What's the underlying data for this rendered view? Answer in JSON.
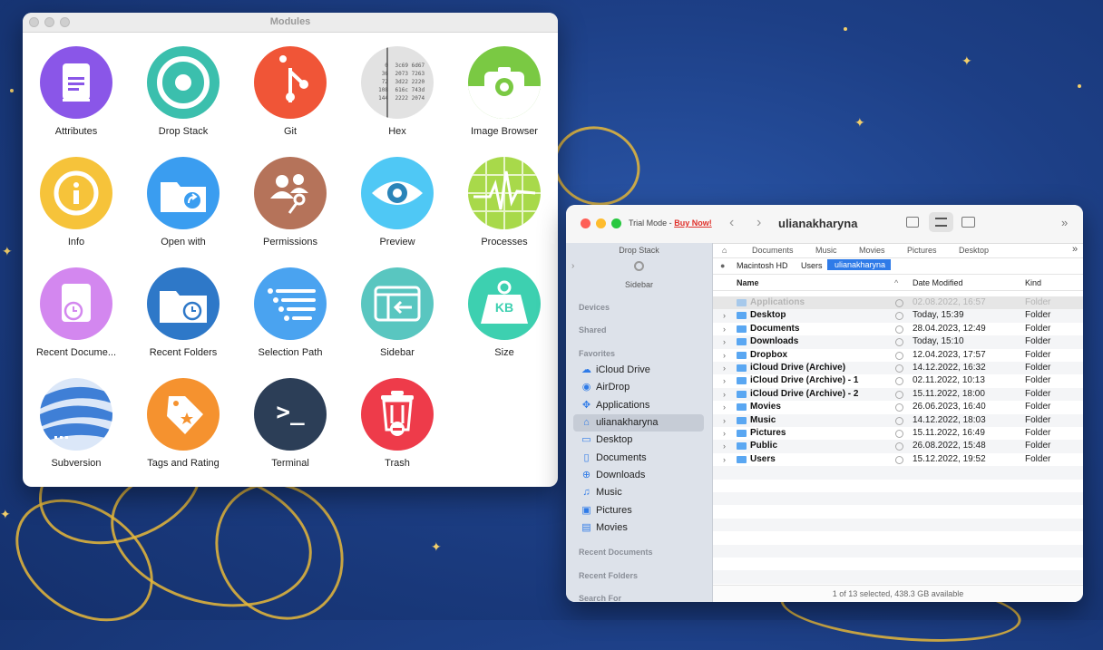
{
  "modules_window": {
    "title": "Modules",
    "modules": [
      {
        "label": "Attributes",
        "color": "#8a56e8",
        "icon": "document-icon"
      },
      {
        "label": "Drop Stack",
        "color": "#3bbfad",
        "icon": "target-icon"
      },
      {
        "label": "Git",
        "color": "#f05537",
        "icon": "git-branch-icon"
      },
      {
        "label": "Hex",
        "color": "#e2e2e2",
        "icon": "hex-table-icon"
      },
      {
        "label": "Image Browser",
        "color": "#7ac943",
        "icon": "camera-icon"
      },
      {
        "label": "Info",
        "color": "#f6c33a",
        "icon": "info-icon"
      },
      {
        "label": "Open with",
        "color": "#3a9df0",
        "icon": "folder-arrow-icon"
      },
      {
        "label": "Permissions",
        "color": "#b5735a",
        "icon": "users-key-icon"
      },
      {
        "label": "Preview",
        "color": "#4fc8f5",
        "icon": "eye-icon"
      },
      {
        "label": "Processes",
        "color": "#a8d94a",
        "icon": "activity-graph-icon"
      },
      {
        "label": "Recent Docume...",
        "color": "#d387ef",
        "icon": "document-clock-icon"
      },
      {
        "label": "Recent Folders",
        "color": "#2e78c8",
        "icon": "folder-clock-icon"
      },
      {
        "label": "Selection Path",
        "color": "#4aa3f0",
        "icon": "list-path-icon"
      },
      {
        "label": "Sidebar",
        "color": "#59c6c0",
        "icon": "sidebar-arrow-icon"
      },
      {
        "label": "Size",
        "color": "#3dd0b0",
        "icon": "weight-kb-icon"
      },
      {
        "label": "Subversion",
        "color": "#3f7fd6",
        "icon": "subversion-icon"
      },
      {
        "label": "Tags and Rating",
        "color": "#f5922f",
        "icon": "tag-star-icon"
      },
      {
        "label": "Terminal",
        "color": "#2c3e57",
        "icon": "terminal-icon"
      },
      {
        "label": "Trash",
        "color": "#ee3b4a",
        "icon": "trash-icon"
      }
    ],
    "hex_rows": [
      {
        "offset": "0",
        "bytes": "3c69 6d67"
      },
      {
        "offset": "36",
        "bytes": "2073 7263"
      },
      {
        "offset": "72",
        "bytes": "3d22 2220"
      },
      {
        "offset": "108",
        "bytes": "616c 743d"
      },
      {
        "offset": "144",
        "bytes": "2222 2074"
      }
    ],
    "size_badge": "KB",
    "terminal_prompt": ">_"
  },
  "finder": {
    "trial_text": "Trial Mode -",
    "buy_now": "Buy Now!",
    "window_title": "ulianakharyna",
    "sidebar": {
      "drop_stack": "Drop Stack",
      "sidebar_label": "Sidebar",
      "sections": {
        "devices": "Devices",
        "shared": "Shared",
        "favorites": "Favorites",
        "recent_documents": "Recent Documents",
        "recent_folders": "Recent Folders",
        "search_for": "Search For"
      },
      "favorites": [
        {
          "label": "iCloud Drive",
          "icon": "cloud-icon"
        },
        {
          "label": "AirDrop",
          "icon": "airdrop-icon"
        },
        {
          "label": "Applications",
          "icon": "applications-icon"
        },
        {
          "label": "ulianakharyna",
          "icon": "home-icon"
        },
        {
          "label": "Desktop",
          "icon": "desktop-icon"
        },
        {
          "label": "Documents",
          "icon": "document-icon"
        },
        {
          "label": "Downloads",
          "icon": "download-icon"
        },
        {
          "label": "Music",
          "icon": "music-icon"
        },
        {
          "label": "Pictures",
          "icon": "picture-icon"
        },
        {
          "label": "Movies",
          "icon": "film-icon"
        }
      ]
    },
    "favorites_bar": [
      "Documents",
      "Music",
      "Movies",
      "Pictures",
      "Desktop"
    ],
    "path": [
      "Macintosh HD",
      "Users",
      "ulianakharyna"
    ],
    "columns": {
      "name": "Name",
      "date": "Date Modified",
      "kind": "Kind"
    },
    "files": [
      {
        "name": "Applications",
        "date": "02.08.2022, 16:57",
        "kind": "Folder",
        "dim": true
      },
      {
        "name": "Desktop",
        "date": "Today, 15:39",
        "kind": "Folder"
      },
      {
        "name": "Documents",
        "date": "28.04.2023, 12:49",
        "kind": "Folder"
      },
      {
        "name": "Downloads",
        "date": "Today, 15:10",
        "kind": "Folder"
      },
      {
        "name": "Dropbox",
        "date": "12.04.2023, 17:57",
        "kind": "Folder"
      },
      {
        "name": "iCloud Drive (Archive)",
        "date": "14.12.2022, 16:32",
        "kind": "Folder"
      },
      {
        "name": "iCloud Drive (Archive) - 1",
        "date": "02.11.2022, 10:13",
        "kind": "Folder"
      },
      {
        "name": "iCloud Drive (Archive) - 2",
        "date": "15.11.2022, 18:00",
        "kind": "Folder"
      },
      {
        "name": "Movies",
        "date": "26.06.2023, 16:40",
        "kind": "Folder"
      },
      {
        "name": "Music",
        "date": "14.12.2022, 18:03",
        "kind": "Folder"
      },
      {
        "name": "Pictures",
        "date": "15.11.2022, 16:49",
        "kind": "Folder"
      },
      {
        "name": "Public",
        "date": "26.08.2022, 15:48",
        "kind": "Folder"
      },
      {
        "name": "Users",
        "date": "15.12.2022, 19:52",
        "kind": "Folder"
      }
    ],
    "status": "1 of 13 selected, 438.3 GB available"
  }
}
